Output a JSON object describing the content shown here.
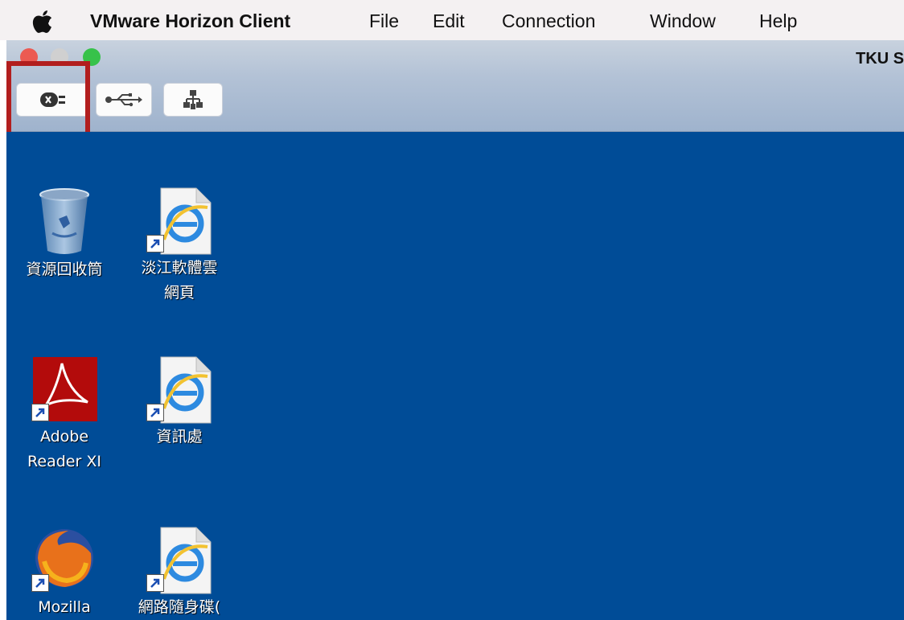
{
  "menubar": {
    "app_name": "VMware Horizon Client",
    "items": [
      "File",
      "Edit",
      "Connection",
      "Window",
      "Help"
    ]
  },
  "window": {
    "title": "TKU S",
    "toolbar": [
      {
        "icon": "disconnect-icon"
      },
      {
        "icon": "usb-icon"
      },
      {
        "icon": "network-icon"
      }
    ]
  },
  "desktop": {
    "background": "#004c97",
    "icons": [
      {
        "label": "資源回收筒",
        "icon": "recycle-bin-icon"
      },
      {
        "label": "淡江軟體雲\n網頁",
        "icon": "internet-explorer-icon"
      },
      {
        "label": "Adobe\nReader XI",
        "icon": "adobe-reader-icon"
      },
      {
        "label": "資訊處",
        "icon": "internet-explorer-icon"
      },
      {
        "label": "Mozilla",
        "icon": "firefox-icon"
      },
      {
        "label": "網路隨身碟(",
        "icon": "internet-explorer-icon"
      }
    ]
  },
  "colors": {
    "highlight": "#b21e1e",
    "desktop": "#004c97"
  }
}
